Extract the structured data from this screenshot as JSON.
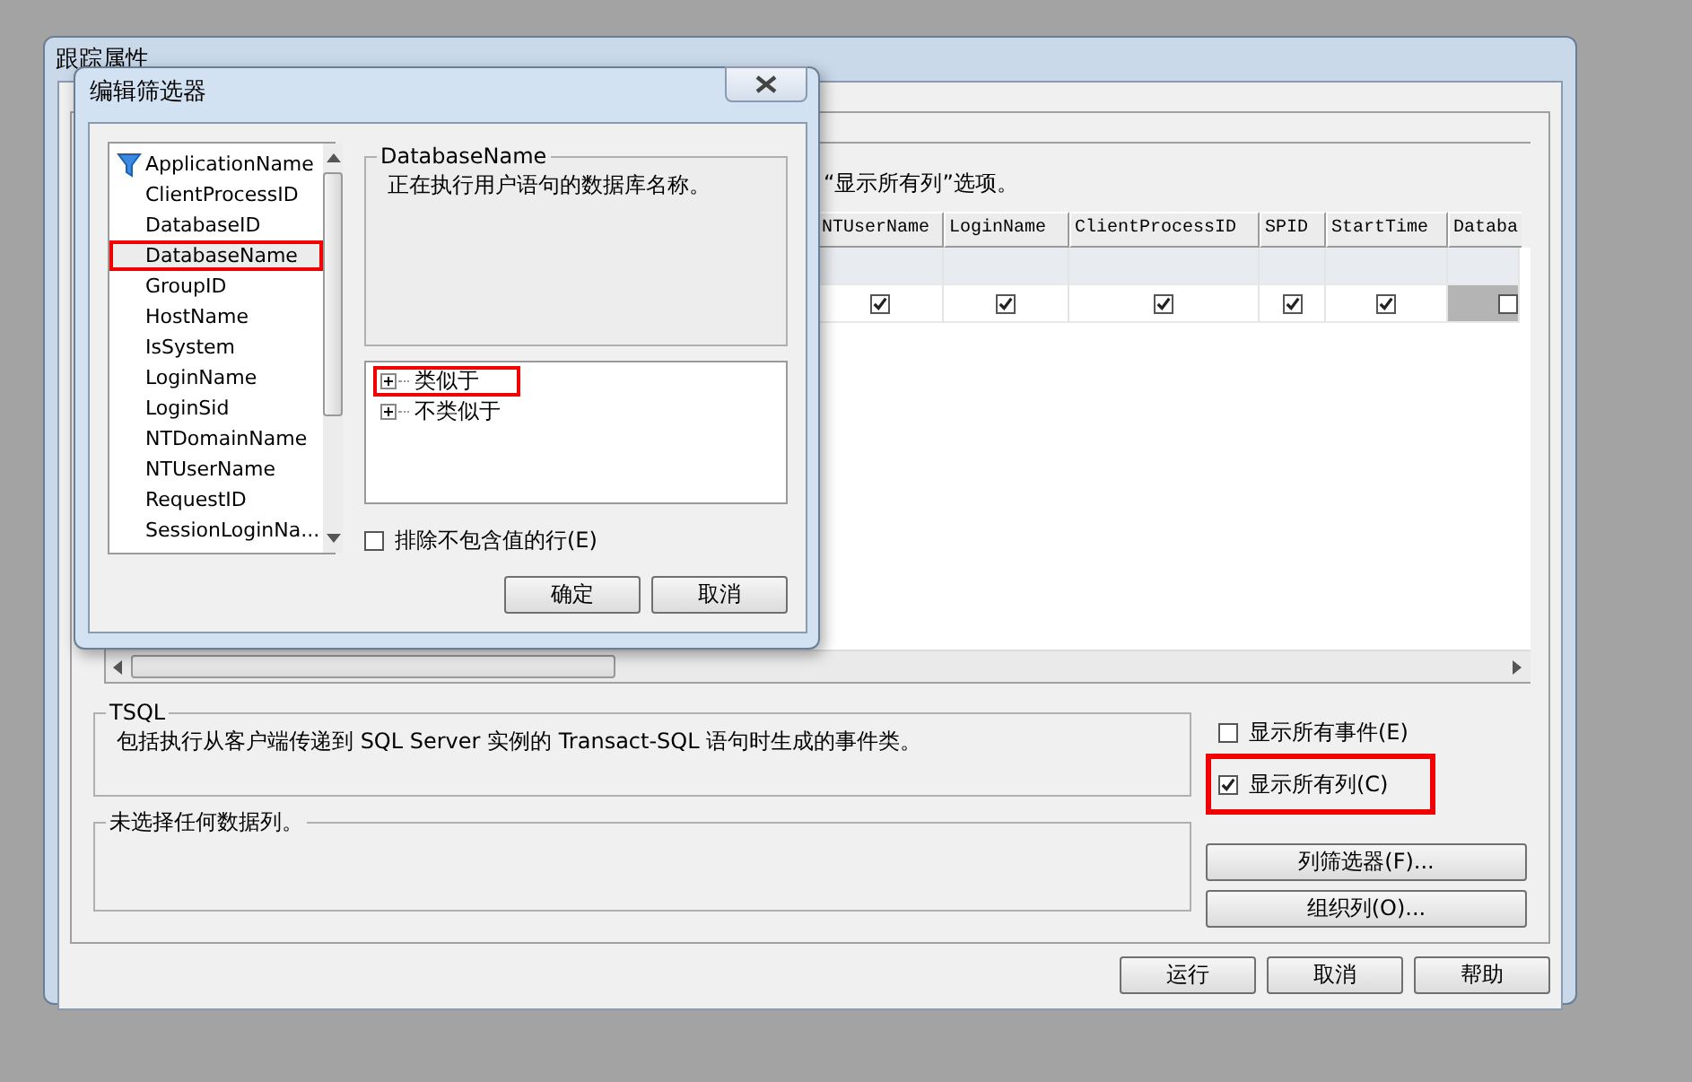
{
  "window": {
    "title": "跟踪属性"
  },
  "hint_text": "“显示所有列”选项。",
  "grid": {
    "columns": [
      "NTUserName",
      "LoginName",
      "ClientProcessID",
      "SPID",
      "StartTime",
      "Databa"
    ],
    "cells": [
      {
        "checked": true,
        "selected": false
      },
      {
        "checked": true,
        "selected": false
      },
      {
        "checked": true,
        "selected": false
      },
      {
        "checked": true,
        "selected": false
      },
      {
        "checked": true,
        "selected": false
      },
      {
        "checked": false,
        "selected": true
      }
    ]
  },
  "event_description": {
    "title": "TSQL",
    "text": "包括执行从客户端传递到 SQL Server 实例的 Transact-SQL 语句时生成的事件类。"
  },
  "options": [
    {
      "label": "显示所有事件(E)",
      "checked": false,
      "highlighted": false
    },
    {
      "label": "显示所有列(C)",
      "checked": true,
      "highlighted": true
    }
  ],
  "data_columns_box": {
    "title": "未选择任何数据列。"
  },
  "side_buttons": [
    "列筛选器(F)...",
    "组织列(O)..."
  ],
  "buttons": [
    "运行",
    "取消",
    "帮助"
  ],
  "dialog": {
    "title": "编辑筛选器",
    "columns": [
      {
        "label": "ApplicationName",
        "filtered": true,
        "selected": false,
        "highlighted": false
      },
      {
        "label": "ClientProcessID",
        "filtered": false,
        "selected": false,
        "highlighted": false
      },
      {
        "label": "DatabaseID",
        "filtered": false,
        "selected": false,
        "highlighted": false
      },
      {
        "label": "DatabaseName",
        "filtered": false,
        "selected": true,
        "highlighted": true
      },
      {
        "label": "GroupID",
        "filtered": false,
        "selected": false,
        "highlighted": false
      },
      {
        "label": "HostName",
        "filtered": false,
        "selected": false,
        "highlighted": false
      },
      {
        "label": "IsSystem",
        "filtered": false,
        "selected": false,
        "highlighted": false
      },
      {
        "label": "LoginName",
        "filtered": false,
        "selected": false,
        "highlighted": false
      },
      {
        "label": "LoginSid",
        "filtered": false,
        "selected": false,
        "highlighted": false
      },
      {
        "label": "NTDomainName",
        "filtered": false,
        "selected": false,
        "highlighted": false
      },
      {
        "label": "NTUserName",
        "filtered": false,
        "selected": false,
        "highlighted": false
      },
      {
        "label": "RequestID",
        "filtered": false,
        "selected": false,
        "highlighted": false
      },
      {
        "label": "SessionLoginNa...",
        "filtered": false,
        "selected": false,
        "highlighted": false
      }
    ],
    "description": {
      "title": "DatabaseName",
      "text": "正在执行用户语句的数据库名称。"
    },
    "operators": [
      {
        "label": "类似于",
        "expanded": false,
        "highlighted": true
      },
      {
        "label": "不类似于",
        "expanded": false,
        "highlighted": false
      }
    ],
    "exclude_empty": {
      "label": "排除不包含值的行(E)",
      "checked": false
    },
    "buttons": [
      "确定",
      "取消"
    ]
  }
}
